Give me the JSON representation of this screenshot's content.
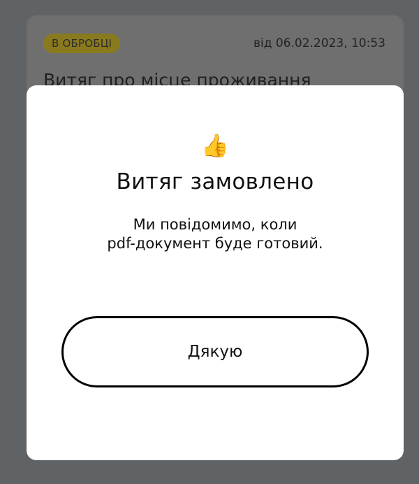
{
  "background_card": {
    "status_badge": "В ОБРОБЦІ",
    "date": "від 06.02.2023, 10:53",
    "title": "Витяг про місце проживання"
  },
  "modal": {
    "icon": "thumbs-up-icon",
    "icon_glyph": "👍",
    "title": "Витяг замовлено",
    "message_line1": "Ми повідомимо, коли",
    "message_line2": "pdf-документ буде готовий.",
    "button_label": "Дякую"
  },
  "colors": {
    "backdrop": "#5f6366",
    "modal_bg": "#ffffff",
    "badge_bg": "#8a7a1e",
    "button_border": "#000000"
  }
}
